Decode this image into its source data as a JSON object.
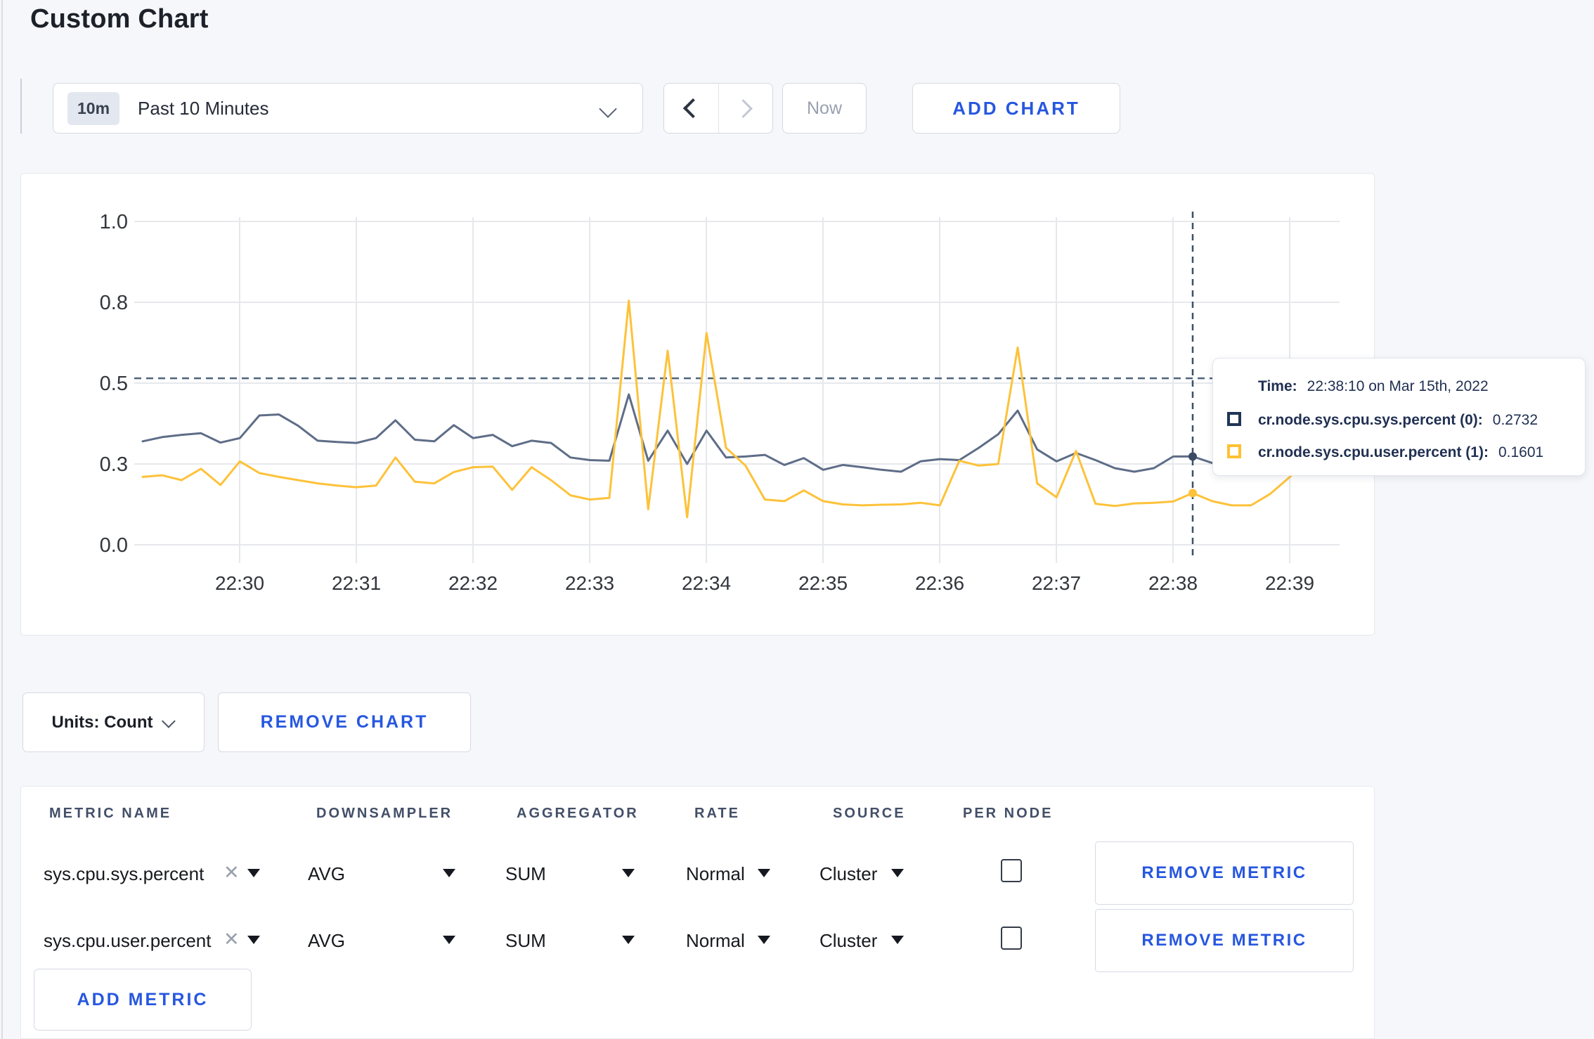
{
  "page": {
    "title": "Custom Chart"
  },
  "toolbar": {
    "range_badge": "10m",
    "range_label": "Past 10 Minutes",
    "now_label": "Now",
    "add_chart_label": "ADD CHART"
  },
  "chart": {
    "units_label": "Units: Count",
    "remove_chart_label": "REMOVE CHART",
    "tooltip": {
      "time_label": "Time:",
      "time_value": "22:38:10 on Mar 15th, 2022",
      "series": [
        {
          "name": "cr.node.sys.cpu.sys.percent (0):",
          "value": "0.2732",
          "swatch_color": "#213556"
        },
        {
          "name": "cr.node.sys.cpu.user.percent (1):",
          "value": "0.1601",
          "swatch_color": "#ffc133"
        }
      ]
    }
  },
  "chart_data": {
    "type": "line",
    "title": "",
    "xlabel": "",
    "ylabel": "",
    "ylim": [
      0,
      1
    ],
    "grid": true,
    "x_start_time": "22:29:10",
    "x_end_time": "22:39:10",
    "interval_seconds": 10,
    "x_tick_labels": [
      "22:30",
      "22:31",
      "22:32",
      "22:33",
      "22:34",
      "22:35",
      "22:36",
      "22:37",
      "22:38",
      "22:39"
    ],
    "y_tick_labels": [
      "0.0",
      "0.3",
      "0.5",
      "0.8",
      "1.0"
    ],
    "y_tick_values": [
      0,
      0.25,
      0.5,
      0.75,
      1.0
    ],
    "crosshair": {
      "time": "22:38:10",
      "index": 54,
      "hline_value": 0.515,
      "series_values": [
        0.2732,
        0.1601
      ]
    },
    "series": [
      {
        "name": "cr.node.sys.cpu.sys.percent (0)",
        "color": "#5e6d87",
        "values": [
          0.32,
          0.333,
          0.34,
          0.345,
          0.316,
          0.33,
          0.4,
          0.403,
          0.368,
          0.322,
          0.318,
          0.315,
          0.33,
          0.385,
          0.325,
          0.32,
          0.37,
          0.33,
          0.34,
          0.305,
          0.322,
          0.315,
          0.27,
          0.262,
          0.26,
          0.465,
          0.26,
          0.353,
          0.25,
          0.353,
          0.27,
          0.273,
          0.278,
          0.247,
          0.268,
          0.232,
          0.247,
          0.24,
          0.232,
          0.226,
          0.258,
          0.265,
          0.262,
          0.3,
          0.342,
          0.415,
          0.295,
          0.258,
          0.284,
          0.262,
          0.237,
          0.226,
          0.237,
          0.273,
          0.2732,
          0.253,
          0.272,
          0.287,
          0.295,
          0.3,
          0.302
        ]
      },
      {
        "name": "cr.node.sys.cpu.user.percent (1)",
        "color": "#fdc23a",
        "values": [
          0.21,
          0.215,
          0.2,
          0.235,
          0.185,
          0.258,
          0.222,
          0.21,
          0.2,
          0.19,
          0.183,
          0.178,
          0.183,
          0.27,
          0.195,
          0.19,
          0.225,
          0.24,
          0.242,
          0.17,
          0.24,
          0.2,
          0.153,
          0.14,
          0.145,
          0.755,
          0.11,
          0.6,
          0.085,
          0.655,
          0.3,
          0.245,
          0.14,
          0.135,
          0.168,
          0.135,
          0.125,
          0.122,
          0.124,
          0.125,
          0.13,
          0.122,
          0.26,
          0.245,
          0.25,
          0.61,
          0.19,
          0.147,
          0.29,
          0.127,
          0.12,
          0.128,
          0.13,
          0.134,
          0.1601,
          0.135,
          0.122,
          0.122,
          0.158,
          0.21,
          0.27
        ]
      }
    ]
  },
  "metrics_table": {
    "headers": [
      "METRIC NAME",
      "DOWNSAMPLER",
      "AGGREGATOR",
      "RATE",
      "SOURCE",
      "PER NODE"
    ],
    "rows": [
      {
        "metric": "sys.cpu.sys.percent",
        "downsampler": "AVG",
        "aggregator": "SUM",
        "rate": "Normal",
        "source": "Cluster",
        "per_node": false,
        "remove_label": "REMOVE METRIC"
      },
      {
        "metric": "sys.cpu.user.percent",
        "downsampler": "AVG",
        "aggregator": "SUM",
        "rate": "Normal",
        "source": "Cluster",
        "per_node": false,
        "remove_label": "REMOVE METRIC"
      }
    ],
    "add_metric_label": "ADD METRIC"
  }
}
